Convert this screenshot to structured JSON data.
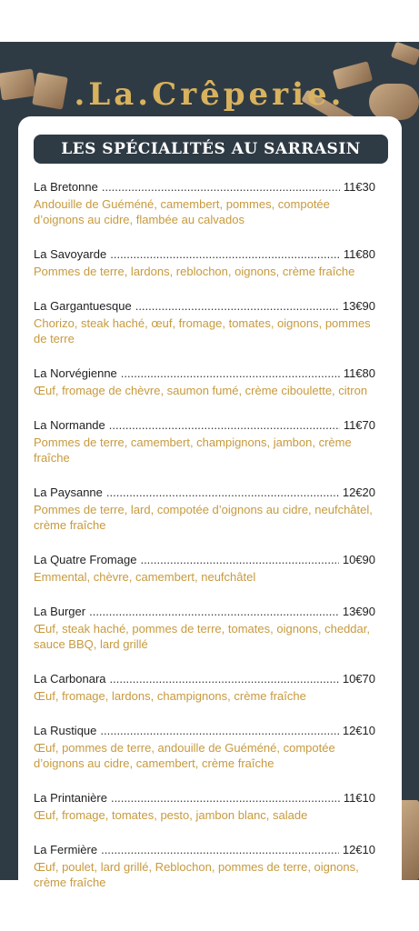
{
  "header": {
    "title": ".La.Crêperie."
  },
  "banner": {
    "title": "LES SPÉCIALITÉS AU SARRASIN"
  },
  "menu": [
    {
      "name": "La Bretonne",
      "price": "11€30",
      "desc": "Andouille de Guéméné, camembert, pommes, compotée d’oignons au cidre, flambée au calvados"
    },
    {
      "name": "La Savoyarde",
      "price": "11€80",
      "desc": "Pommes de terre, lardons, reblochon, oignons, crème fraîche"
    },
    {
      "name": "La Gargantuesque",
      "price": "13€90",
      "desc": "Chorizo, steak haché, œuf, fromage, tomates, oignons, pommes de terre"
    },
    {
      "name": "La Norvégienne",
      "price": "11€80",
      "desc": "Œuf, fromage de chèvre, saumon fumé, crème ciboulette, citron"
    },
    {
      "name": "La Normande",
      "price": "11€70",
      "desc": "Pommes de terre, camembert, champignons, jambon, crème fraîche"
    },
    {
      "name": "La Paysanne",
      "price": "12€20",
      "desc": "Pommes de terre, lard, compotée d’oignons au cidre, neufchâtel, crème  fraîche"
    },
    {
      "name": "La Quatre Fromage",
      "price": "10€90",
      "desc": "Emmental, chèvre, camembert, neufchâtel"
    },
    {
      "name": "La Burger",
      "price": "13€90",
      "desc": "Œuf, steak haché, pommes de terre, tomates, oignons, cheddar, sauce BBQ, lard grillé"
    },
    {
      "name": "La Carbonara",
      "price": "10€70",
      "desc": "Œuf, fromage, lardons, champignons, crème fraîche"
    },
    {
      "name": "La Rustique",
      "price": "12€10",
      "desc": "Œuf, pommes de terre, andouille de Guéméné, compotée d’oignons au cidre, camembert, crème fraîche"
    },
    {
      "name": "La Printanière",
      "price": "11€10",
      "desc": "Œuf, fromage, tomates, pesto, jambon blanc, salade"
    },
    {
      "name": "La Fermière",
      "price": "12€10",
      "desc": "Œuf, poulet, lard grillé, Reblochon, pommes de terre, oignons, crème fraîche"
    }
  ]
}
